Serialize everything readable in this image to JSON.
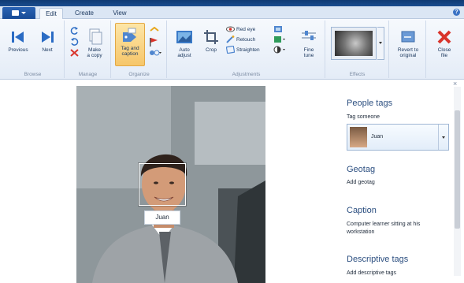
{
  "tabs": [
    {
      "label": "Edit"
    },
    {
      "label": "Create"
    },
    {
      "label": "View"
    }
  ],
  "ribbon": {
    "browse": {
      "label": "Browse",
      "previous": "Previous",
      "next": "Next"
    },
    "manage": {
      "label": "Manage",
      "make_copy_line1": "Make",
      "make_copy_line2": "a copy"
    },
    "organize": {
      "label": "Organize",
      "tag_caption_line1": "Tag and",
      "tag_caption_line2": "caption"
    },
    "adjustments": {
      "label": "Adjustments",
      "auto_adjust_line1": "Auto",
      "auto_adjust_line2": "adjust",
      "crop": "Crop",
      "red_eye": "Red eye",
      "retouch": "Retouch",
      "straighten": "Straighten",
      "fine_tune_line1": "Fine",
      "fine_tune_line2": "tune"
    },
    "effects": {
      "label": "Effects"
    },
    "revert_line1": "Revert to",
    "revert_line2": "original",
    "close_line1": "Close",
    "close_line2": "file"
  },
  "photo": {
    "face_tag": "Juan"
  },
  "pane": {
    "people_tags": "People tags",
    "tag_someone": "Tag someone",
    "selected_person": "Juan",
    "geotag": "Geotag",
    "add_geotag": "Add geotag",
    "caption": "Caption",
    "caption_text_line1": "Computer learner sitting at his",
    "caption_text_line2": "workstation",
    "descriptive_tags": "Descriptive tags",
    "add_descriptive_tags": "Add descriptive tags"
  },
  "colors": {
    "accent": "#2c4f80",
    "close_red": "#d9342b",
    "tag_highlight": "#f6c66a"
  }
}
